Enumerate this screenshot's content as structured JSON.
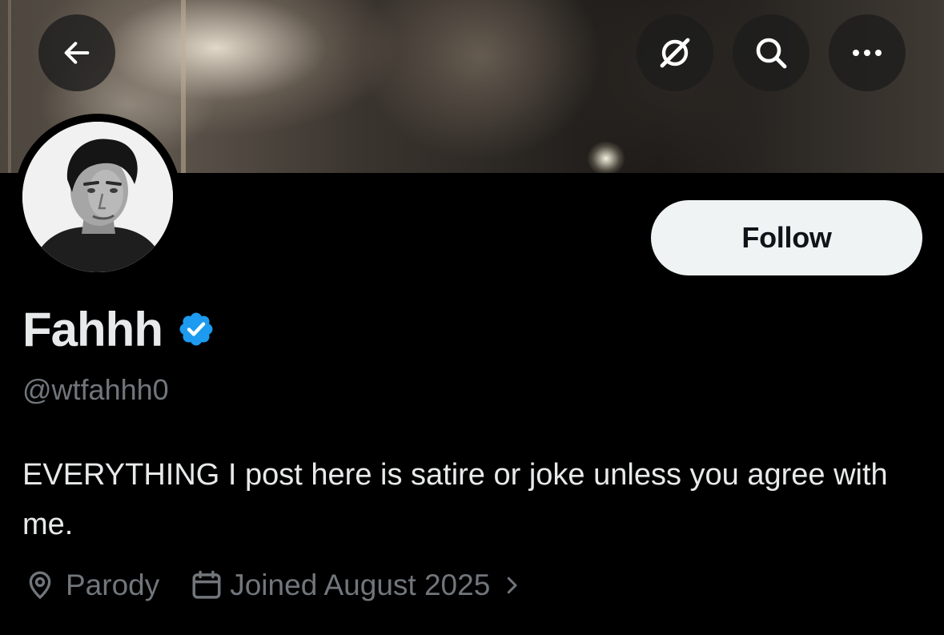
{
  "header": {
    "back_icon": "arrow-left-icon",
    "grok_icon": "grok-icon",
    "search_icon": "search-icon",
    "more_icon": "more-dots-icon"
  },
  "profile": {
    "display_name": "Fahhh",
    "verified": true,
    "verified_color": "#1d9bf0",
    "handle": "@wtfahhh0",
    "bio": "EVERYTHING I post here is satire or joke unless you agree with me.",
    "location": "Parody",
    "joined": "Joined August 2025",
    "location_icon": "location-pin-icon",
    "calendar_icon": "calendar-icon",
    "chevron_icon": "chevron-right-icon"
  },
  "actions": {
    "follow_label": "Follow"
  },
  "theme": {
    "background": "#000000",
    "primary_text": "#e7e9ea",
    "secondary_text": "#71767b",
    "follow_bg": "#eff3f4",
    "follow_text": "#0f1419"
  }
}
